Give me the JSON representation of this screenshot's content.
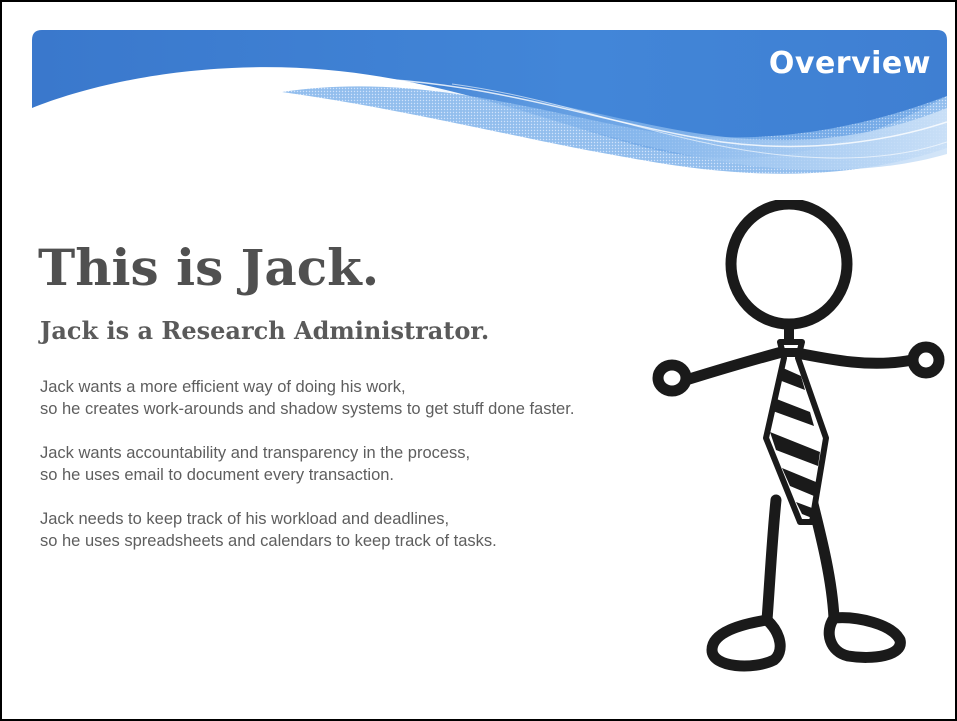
{
  "slide": {
    "banner_title": "Overview",
    "heading": "This is Jack.",
    "subheading": "Jack is a Research Administrator.",
    "paragraphs": [
      {
        "line1": "Jack wants a more efficient way of doing his work,",
        "line2": "so he creates work-arounds and shadow systems to get stuff done faster."
      },
      {
        "line1": "Jack wants accountability and transparency in the process,",
        "line2": "so he uses email to document every transaction."
      },
      {
        "line1": "Jack needs to keep track of his workload and deadlines,",
        "line2": "so he uses spreadsheets and calendars to keep track of tasks."
      }
    ]
  },
  "colors": {
    "banner_blue": "#3f7fd2",
    "banner_light": "#7fb2ea",
    "heading_gray": "#505050",
    "text_gray": "#5e5e5e"
  },
  "illustration": {
    "icon": "stick-figure-with-striped-tie"
  }
}
